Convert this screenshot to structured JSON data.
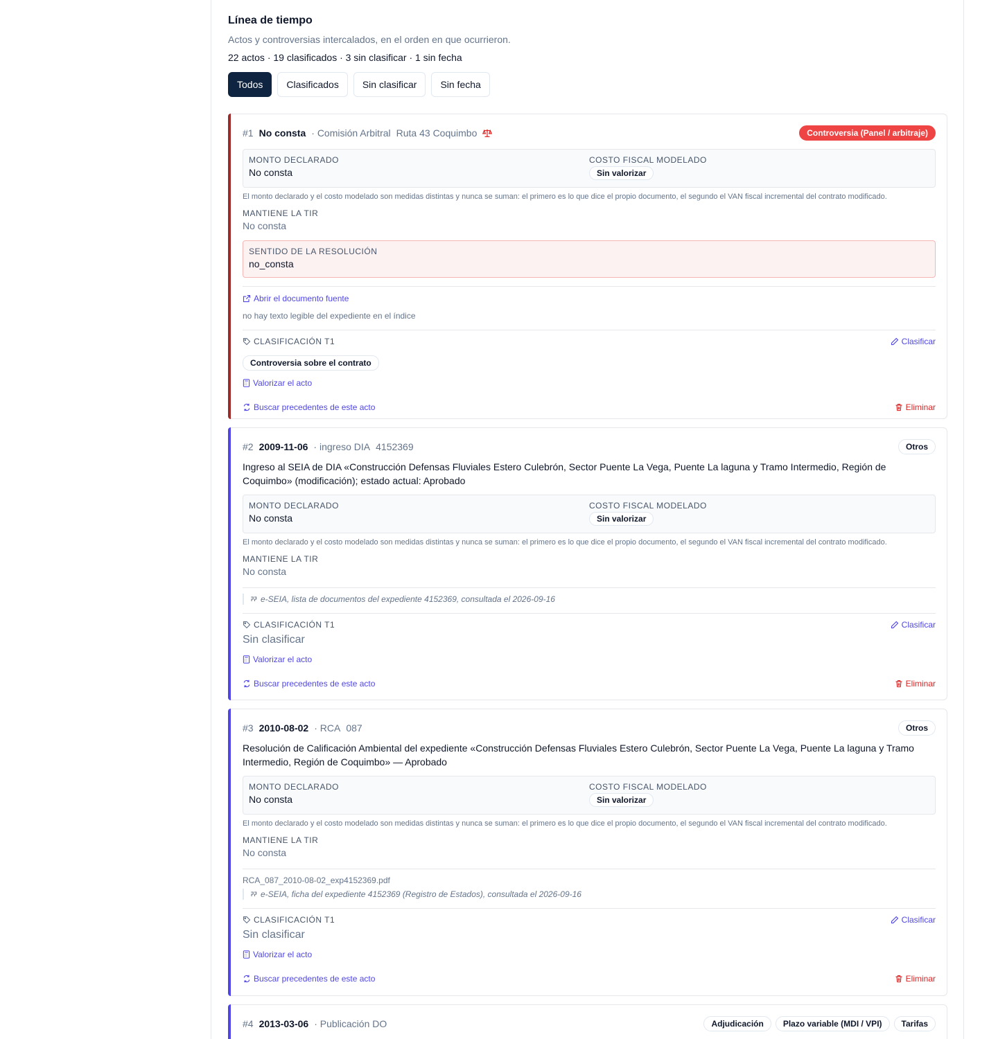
{
  "header": {
    "title": "Línea de tiempo",
    "subtitle": "Actos y controversias intercalados, en el orden en que ocurrieron.",
    "stats": "22 actos · 19 clasificados · 3 sin clasificar · 1 sin fecha"
  },
  "filters": [
    {
      "label": "Todos",
      "active": true
    },
    {
      "label": "Clasificados",
      "active": false
    },
    {
      "label": "Sin clasificar",
      "active": false
    },
    {
      "label": "Sin fecha",
      "active": false
    }
  ],
  "labels": {
    "monto": "MONTO DECLARADO",
    "costo": "COSTO FISCAL MODELADO",
    "note": "El monto declarado y el costo modelado son medidas distintas y nunca se suman: el primero es lo que dice el propio documento, el segundo el VAN fiscal incremental del contrato modificado.",
    "tir": "MANTIENE LA TIR",
    "resolucion": "SENTIDO DE LA RESOLUCIÓN",
    "clasificacion": "CLASIFICACIÓN T1",
    "clasificar": "Clasificar",
    "valorizar": "Valorizar el acto",
    "precedentes": "Buscar precedentes de este acto",
    "eliminar": "Eliminar",
    "abrir": "Abrir el documento fuente",
    "sin_clasificar": "Sin clasificar"
  },
  "colors": {
    "controversy_accent": "#9b2c2c",
    "act_accent": "#4f46e5",
    "active_filter": "#0f2440",
    "red_badge": "#ef4444"
  },
  "acts": [
    {
      "num": "#1",
      "date": "No consta",
      "kind": "· Comisión Arbitral",
      "ref": "Ruta 43 Coquimbo",
      "badges": [
        "Controversia (Panel / arbitraje)"
      ],
      "monto": "No consta",
      "costo": "Sin valorizar",
      "tir": "No consta",
      "resolucion": "no_consta",
      "no_text": "no hay texto legible del expediente en el índice",
      "classification": "Controversia sobre el contrato"
    },
    {
      "num": "#2",
      "date": "2009-11-06",
      "kind": "· ingreso DIA",
      "ref": "4152369",
      "badges": [
        "Otros"
      ],
      "description": "Ingreso al SEIA de DIA «Construcción Defensas Fluviales Estero Culebrón, Sector Puente La Vega, Puente La laguna y Tramo Intermedio, Región de Coquimbo» (modificación); estado actual: Aprobado",
      "monto": "No consta",
      "costo": "Sin valorizar",
      "tir": "No consta",
      "source": "e-SEIA, lista de documentos del expediente 4152369, consultada el 2026-09-16",
      "classification": "Sin clasificar"
    },
    {
      "num": "#3",
      "date": "2010-08-02",
      "kind": "· RCA",
      "ref": "087",
      "badges": [
        "Otros"
      ],
      "description": "Resolución de Calificación Ambiental del expediente «Construcción Defensas Fluviales Estero Culebrón, Sector Puente La Vega, Puente La laguna y Tramo Intermedio, Región de Coquimbo» — Aprobado",
      "monto": "No consta",
      "costo": "Sin valorizar",
      "tir": "No consta",
      "file": "RCA_087_2010-08-02_exp4152369.pdf",
      "source": "e-SEIA, ficha del expediente 4152369 (Registro de Estados), consultada el 2026-09-16",
      "classification": "Sin clasificar"
    },
    {
      "num": "#4",
      "date": "2013-03-06",
      "kind": "· Publicación DO",
      "ref": "",
      "badges": [
        "Adjudicación",
        "Plazo variable (MDI / VPI)",
        "Tarifas"
      ]
    }
  ]
}
